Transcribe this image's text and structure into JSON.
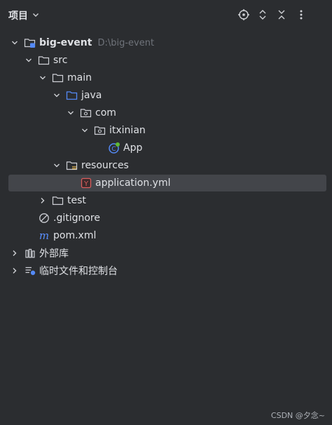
{
  "header": {
    "title": "项目",
    "icons": [
      "target-icon",
      "expand-icon",
      "collapse-icon",
      "more-vertical-icon"
    ]
  },
  "tree": {
    "root": {
      "label": "big-event",
      "path": "D:\\big-event"
    },
    "src": "src",
    "main": "main",
    "java": "java",
    "com": "com",
    "itxinian": "itxinian",
    "app": "App",
    "resources": "resources",
    "application_yml": "application.yml",
    "test": "test",
    "gitignore": ".gitignore",
    "pom": "pom.xml",
    "external_libs": "外部库",
    "scratches": "临时文件和控制台"
  },
  "watermark": "CSDN @夕念~",
  "colors": {
    "background": "#2b2d30",
    "selected_row": "#43454a",
    "folder_blue": "#548af7",
    "yaml_red": "#db5c5c",
    "maven_blue": "#5a8fff"
  }
}
